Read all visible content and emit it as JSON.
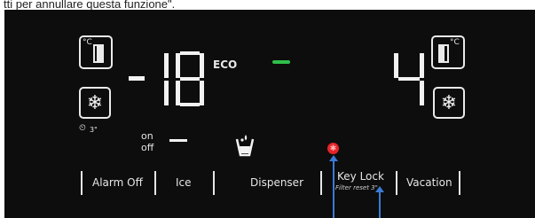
{
  "caption": "tti per annullare questa funzione\".",
  "display": {
    "freezer_sign": "-",
    "freezer_temp": "18",
    "eco_label": "ECO",
    "fridge_temp": "4",
    "celsius_label": "°C",
    "power_freeze_time": "3\"",
    "water_on_label": "on",
    "water_off_label": "off"
  },
  "buttons": [
    {
      "label": "Alarm Off"
    },
    {
      "label": "Ice"
    },
    {
      "label": "Dispenser"
    },
    {
      "label": "Key Lock",
      "sub": "Filter reset 3\""
    },
    {
      "label": "Vacation"
    }
  ],
  "colors": {
    "panel": "#0d0d0d",
    "segment": "#f2f2f2",
    "eco_indicator": "#2fbf4a",
    "lock_indicator": "#e8242a",
    "pointer": "#3a7bd5"
  },
  "icons": [
    "freezer-celsius-icon",
    "snowflake-icon",
    "fridge-celsius-icon",
    "water-drop-cup-icon",
    "lock-indicator-icon"
  ]
}
